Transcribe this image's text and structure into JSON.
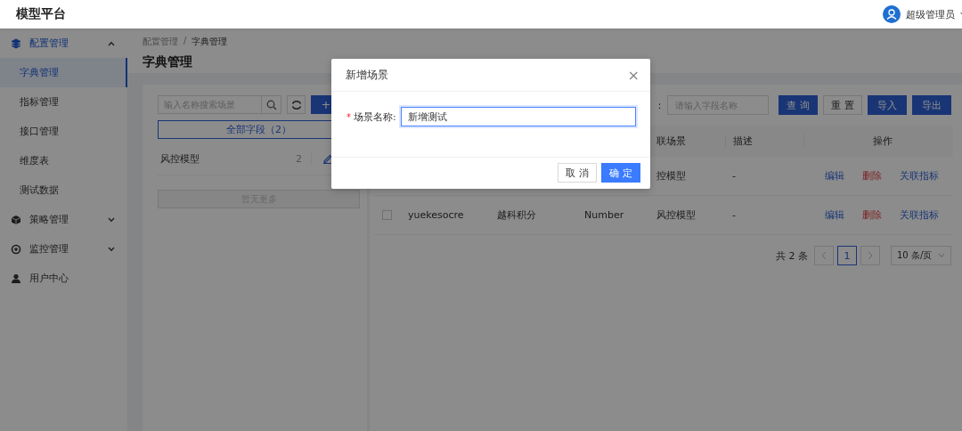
{
  "app": {
    "title": "模型平台",
    "user": "超级管理员"
  },
  "sidebar": {
    "items": [
      {
        "label": "配置管理",
        "expanded": true,
        "children": [
          {
            "label": "字典管理",
            "selected": true
          },
          {
            "label": "指标管理",
            "selected": false
          },
          {
            "label": "接口管理",
            "selected": false
          },
          {
            "label": "维度表",
            "selected": false
          },
          {
            "label": "测试数据",
            "selected": false
          }
        ]
      },
      {
        "label": "策略管理",
        "expanded": false
      },
      {
        "label": "监控管理",
        "expanded": false
      },
      {
        "label": "用户中心"
      }
    ]
  },
  "breadcrumb": {
    "separator": "/",
    "items": [
      "配置管理",
      "字典管理"
    ]
  },
  "page_title": "字典管理",
  "scenes": {
    "search_placeholder": "输入名称搜索场景",
    "add_label": "+",
    "all_button": "全部字段（2）",
    "all_selected": true,
    "items": [
      {
        "name": "风控模型",
        "count": "2"
      }
    ],
    "more": "暂无更多"
  },
  "filter": {
    "label": "：",
    "placeholder": "请输入字段名称",
    "buttons": [
      {
        "label": "查 询",
        "kind": "primary"
      },
      {
        "label": "重 置",
        "kind": "default"
      },
      {
        "label": "导入",
        "kind": "primary"
      },
      {
        "label": "导出",
        "kind": "primary"
      }
    ]
  },
  "table": {
    "columns": [
      {
        "label": "联场景"
      },
      {
        "label": "描述"
      },
      {
        "label": "操作"
      }
    ],
    "rows": [
      {
        "scene": "控模型",
        "description": "-",
        "actions": [
          {
            "label": "编辑",
            "kind": "edit"
          },
          {
            "label": "删除",
            "kind": "delete"
          },
          {
            "label": "关联指标",
            "kind": "link"
          }
        ]
      },
      {
        "checked": false,
        "field": "yuekesocre",
        "name": "越科积分",
        "type": "Number",
        "scene": "风控模型",
        "description": "-",
        "actions": [
          {
            "label": "编辑",
            "kind": "edit"
          },
          {
            "label": "删除",
            "kind": "delete"
          },
          {
            "label": "关联指标",
            "kind": "link"
          }
        ]
      }
    ]
  },
  "pagination": {
    "total": "共 2 条",
    "pages": [
      {
        "label": "1",
        "selected": true
      }
    ],
    "page_size": "10 条/页"
  },
  "dialog": {
    "title": "新增场景",
    "close": "×",
    "field": {
      "required_mark": "*",
      "label": "场景名称:",
      "value": "新增测试",
      "focused": true
    },
    "buttons": [
      {
        "label": "取 消",
        "kind": "default"
      },
      {
        "label": "确 定",
        "kind": "primary"
      }
    ]
  }
}
